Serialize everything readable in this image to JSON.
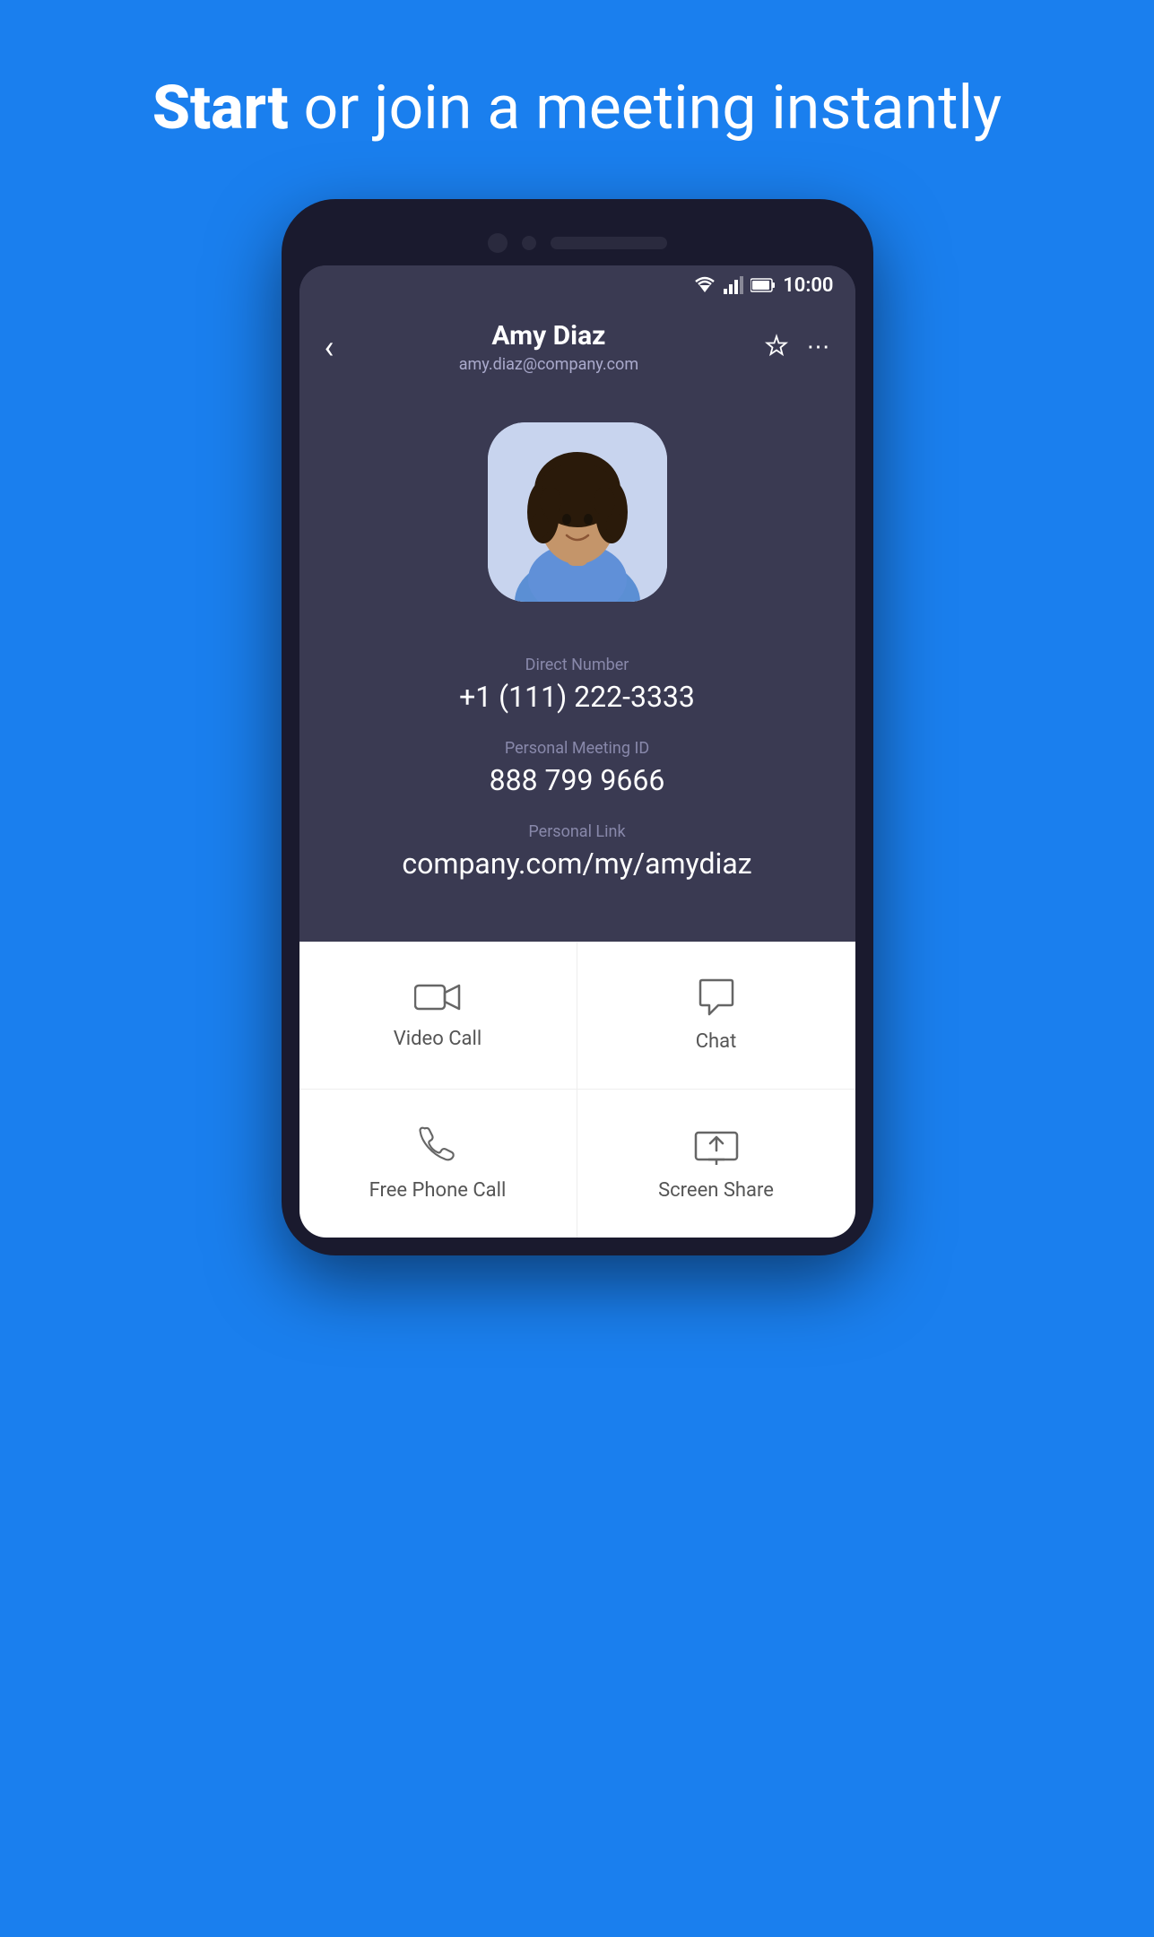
{
  "header": {
    "title_bold": "Start",
    "title_rest": " or join a meeting instantly"
  },
  "statusBar": {
    "time": "10:00"
  },
  "contact": {
    "name": "Amy Diaz",
    "email": "amy.diaz@company.com",
    "directNumberLabel": "Direct Number",
    "directNumber": "+1 (111) 222-3333",
    "meetingIdLabel": "Personal Meeting ID",
    "meetingId": "888 799 9666",
    "personalLinkLabel": "Personal Link",
    "personalLink": "company.com/my/amydiaz"
  },
  "actions": {
    "videoCall": "Video Call",
    "chat": "Chat",
    "freePhoneCall": "Free Phone Call",
    "screenShare": "Screen Share"
  }
}
